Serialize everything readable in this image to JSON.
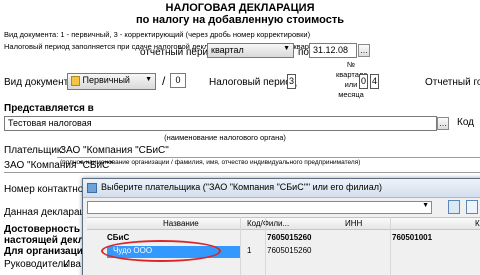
{
  "doc": {
    "title_line1": "НАЛОГОВАЯ ДЕКЛАРАЦИЯ",
    "title_line2": "по налогу на добавленную стоимость",
    "note1": "Вид документа: 1 - первичный, 3 - корректирующий (через дробь номер корректировки)",
    "note2": "Налоговый период заполняется при сдаче налоговой декларации: за месяц - 1, за квартал - 3",
    "report_period_label": "отчетный период",
    "report_period_value": "квартал",
    "po_label": "по",
    "po_date": "31.12.08",
    "doc_kind_label": "Вид документа",
    "doc_kind_value": "Первичный",
    "slash": "/",
    "doc_kind_num": "0",
    "tax_period_label": "Налоговый период",
    "tax_period_value": "3",
    "quarter_label_l1": "№",
    "quarter_label_l2": "квартала",
    "quarter_label_l3": "или",
    "quarter_label_l4": "месяца",
    "quarter_d1": "0",
    "quarter_d2": "4",
    "report_year_label": "Отчетный го",
    "presented_label": "Представляется в",
    "tax_authority_value": "Тестовая налоговая",
    "code_label": "Код",
    "tax_authority_caption": "(наименование налогового органа)",
    "payer_label": "Плательщик:",
    "payer_value": "ЗАО \"Компания \"СБиС\"",
    "payer_caption": "(полное наименование организации / фамилия, имя, отчество индивидуального предпринимателя)",
    "payer_value2": "ЗАО \"Компания \"СБиС\"",
    "contact_label": "Номер контактног",
    "decl_date_label": "Данная деклараци",
    "accuracy_label_l1": "Достоверность и",
    "accuracy_label_l2": "настоящей декла",
    "org_label": "Для организаци",
    "head_label": "Руководитель",
    "head_value": "Ива"
  },
  "dialog": {
    "title": "Выберите плательщика (\"ЗАО \"Компания \"СБиС\"\" или его филиал)",
    "columns": [
      "Название",
      "Код/Фили...",
      "ИНН",
      "КП"
    ],
    "rows": [
      {
        "name": "СБиС",
        "code": "",
        "inn": "7605015260",
        "kpp": "760501001",
        "bold": true,
        "selected": false
      },
      {
        "name": "Чудо ООО",
        "code": "1",
        "inn": "7605015260",
        "kpp": "",
        "bold": false,
        "selected": true
      }
    ]
  },
  "colors": {
    "selection": "#3399ff",
    "highlight_ellipse": "#d9262a"
  }
}
